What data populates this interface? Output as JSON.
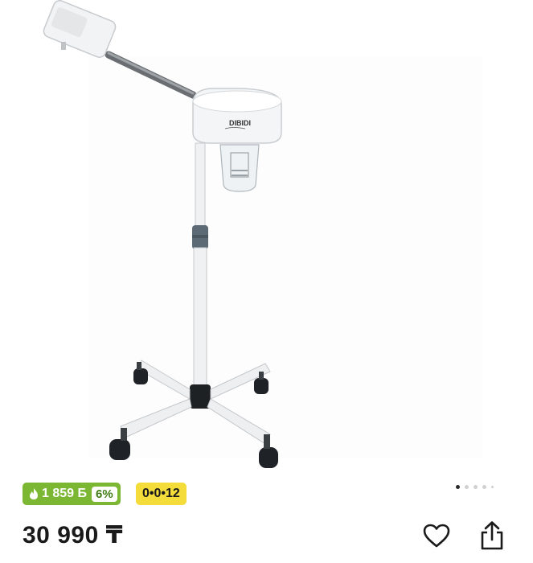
{
  "gallery": {
    "dots_count": 5,
    "active_index": 0
  },
  "bonus": {
    "amount": "1 859 Б",
    "percent": "6%",
    "color": "#7cb733"
  },
  "installment": {
    "label": "0•0•12",
    "color": "#f4dd3a"
  },
  "product": {
    "price": "30 990 ₸",
    "brand_text": "DIBIDI"
  },
  "icons": {
    "favorite": "heart-icon",
    "share": "share-icon",
    "bonus": "flame-icon"
  },
  "colors": {
    "accent": "#d9392b"
  }
}
